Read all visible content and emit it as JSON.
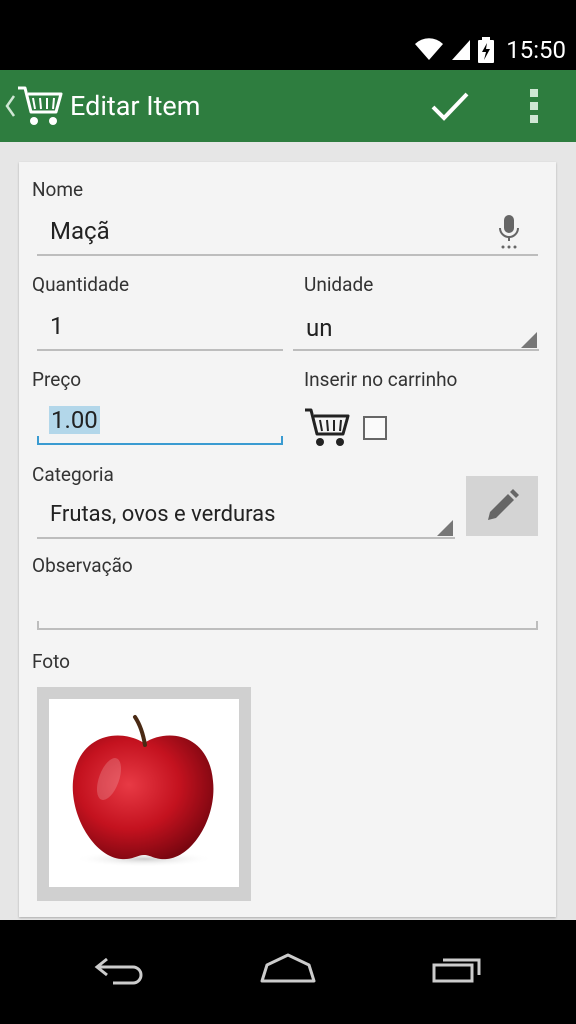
{
  "status_bar": {
    "time": "15:50",
    "icons": [
      "wifi-icon",
      "signal-icon",
      "battery-charging-icon"
    ]
  },
  "app_bar": {
    "title": "Editar Item",
    "icons": [
      "back-chevron-icon",
      "cart-icon",
      "check-icon",
      "overflow-menu-icon"
    ]
  },
  "form": {
    "nome": {
      "label": "Nome",
      "value": "Maçã",
      "icon": "microphone-icon"
    },
    "quantidade": {
      "label": "Quantidade",
      "value": "1"
    },
    "unidade": {
      "label": "Unidade",
      "value": "un"
    },
    "preco": {
      "label": "Preço",
      "value": "1.00"
    },
    "inserir": {
      "label": "Inserir no carrinho",
      "checked": false
    },
    "categoria": {
      "label": "Categoria",
      "value": "Frutas, ovos e verduras",
      "edit_icon": "pencil-icon"
    },
    "observacao": {
      "label": "Observação",
      "value": ""
    },
    "foto": {
      "label": "Foto",
      "image": "apple-photo"
    }
  },
  "nav_bar": {
    "icons": [
      "back-icon",
      "home-icon",
      "recents-icon"
    ]
  },
  "colors": {
    "app_bar": "#2e7d3f",
    "focus": "#3a9bd1",
    "selection": "#b3d7ea"
  }
}
